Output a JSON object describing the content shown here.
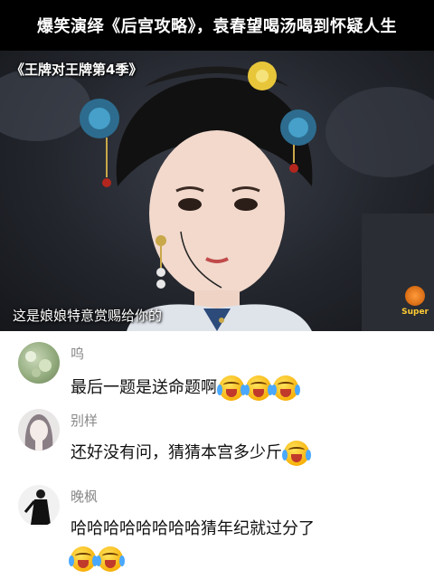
{
  "headline": "爆笑演绎《后宫攻略》，袁春望喝汤喝到怀疑人生",
  "video": {
    "show_title": "《王牌对王牌第4季》",
    "subtitle": "这是娘娘特意赏赐给你的",
    "brand": "Super"
  },
  "comments": [
    {
      "username": "呜",
      "text": "最后一题是送命题啊",
      "emoji": [
        "cry-laugh",
        "cry-laugh",
        "cry-laugh"
      ],
      "avatar": "avatar-green-moss"
    },
    {
      "username": "别样",
      "text": "还好没有问，猜猜本宫多少斤",
      "emoji": [
        "cry-laugh"
      ],
      "avatar": "avatar-girl"
    },
    {
      "username": "晚枫",
      "text": "哈哈哈哈哈哈哈哈猜年纪就过分了",
      "emoji": [
        "cry-laugh",
        "cry-laugh"
      ],
      "avatar": "avatar-dark-figure"
    }
  ]
}
